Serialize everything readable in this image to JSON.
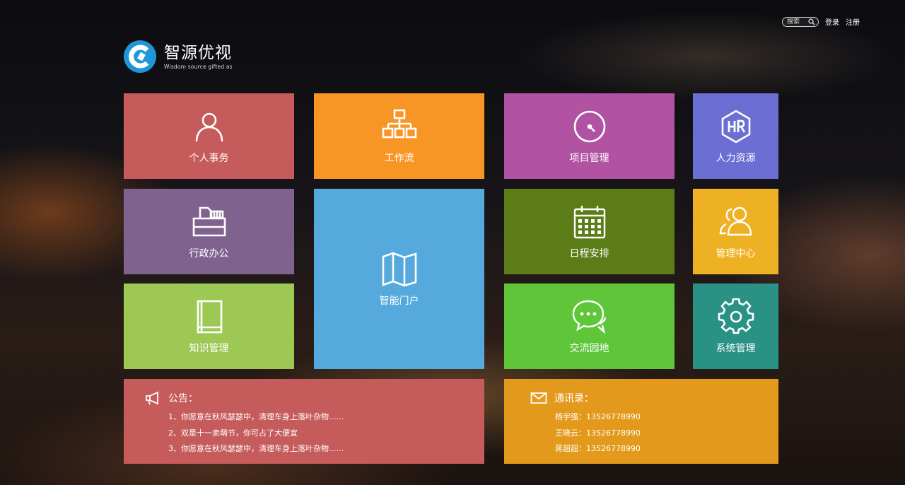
{
  "header": {
    "search": {
      "placeholder": "搜索"
    },
    "login_label": "登录",
    "register_label": "注册"
  },
  "brand": {
    "title": "智源优视",
    "subtitle": "Wisdom source gifted as",
    "color": "#2196d9"
  },
  "tiles": [
    {
      "id": "personal",
      "label": "个人事务",
      "color": "#c55b5a",
      "icon": "user-icon"
    },
    {
      "id": "workflow",
      "label": "工作流",
      "color": "#f79525",
      "icon": "org-chart-icon"
    },
    {
      "id": "project",
      "label": "项目管理",
      "color": "#b153a2",
      "icon": "clock-dial-icon"
    },
    {
      "id": "hr",
      "label": "人力资源",
      "color": "#6b6ed3",
      "icon": "hr-hexagon-icon"
    },
    {
      "id": "admin",
      "label": "行政办公",
      "color": "#80628f",
      "icon": "printer-icon"
    },
    {
      "id": "portal",
      "label": "智能门户",
      "color": "#55a9dd",
      "icon": "map-icon"
    },
    {
      "id": "schedule",
      "label": "日程安排",
      "color": "#5b7c17",
      "icon": "calendar-icon"
    },
    {
      "id": "mgmt",
      "label": "管理中心",
      "color": "#efb124",
      "icon": "users-icon"
    },
    {
      "id": "knowledge",
      "label": "知识管理",
      "color": "#9dc854",
      "icon": "book-icon"
    },
    {
      "id": "forum",
      "label": "交流园地",
      "color": "#5fc63a",
      "icon": "chat-bubbles-icon"
    },
    {
      "id": "system",
      "label": "系统管理",
      "color": "#2a9185",
      "icon": "gear-icon"
    }
  ],
  "notice": {
    "title": "公告：",
    "color": "#c55b5a",
    "items": [
      "1、你愿意在秋风瑟瑟中，清理车身上落叶杂物......",
      "2、双是十一卖萌节，你可占了大便宜",
      "3、你愿意在秋风瑟瑟中，清理车身上落叶杂物......"
    ]
  },
  "contacts": {
    "title": "通讯录：",
    "color": "#e39a1c",
    "items": [
      "杨宇强：13526778990",
      "王晓云：13526778990",
      "蒋超超：13526778990"
    ]
  }
}
